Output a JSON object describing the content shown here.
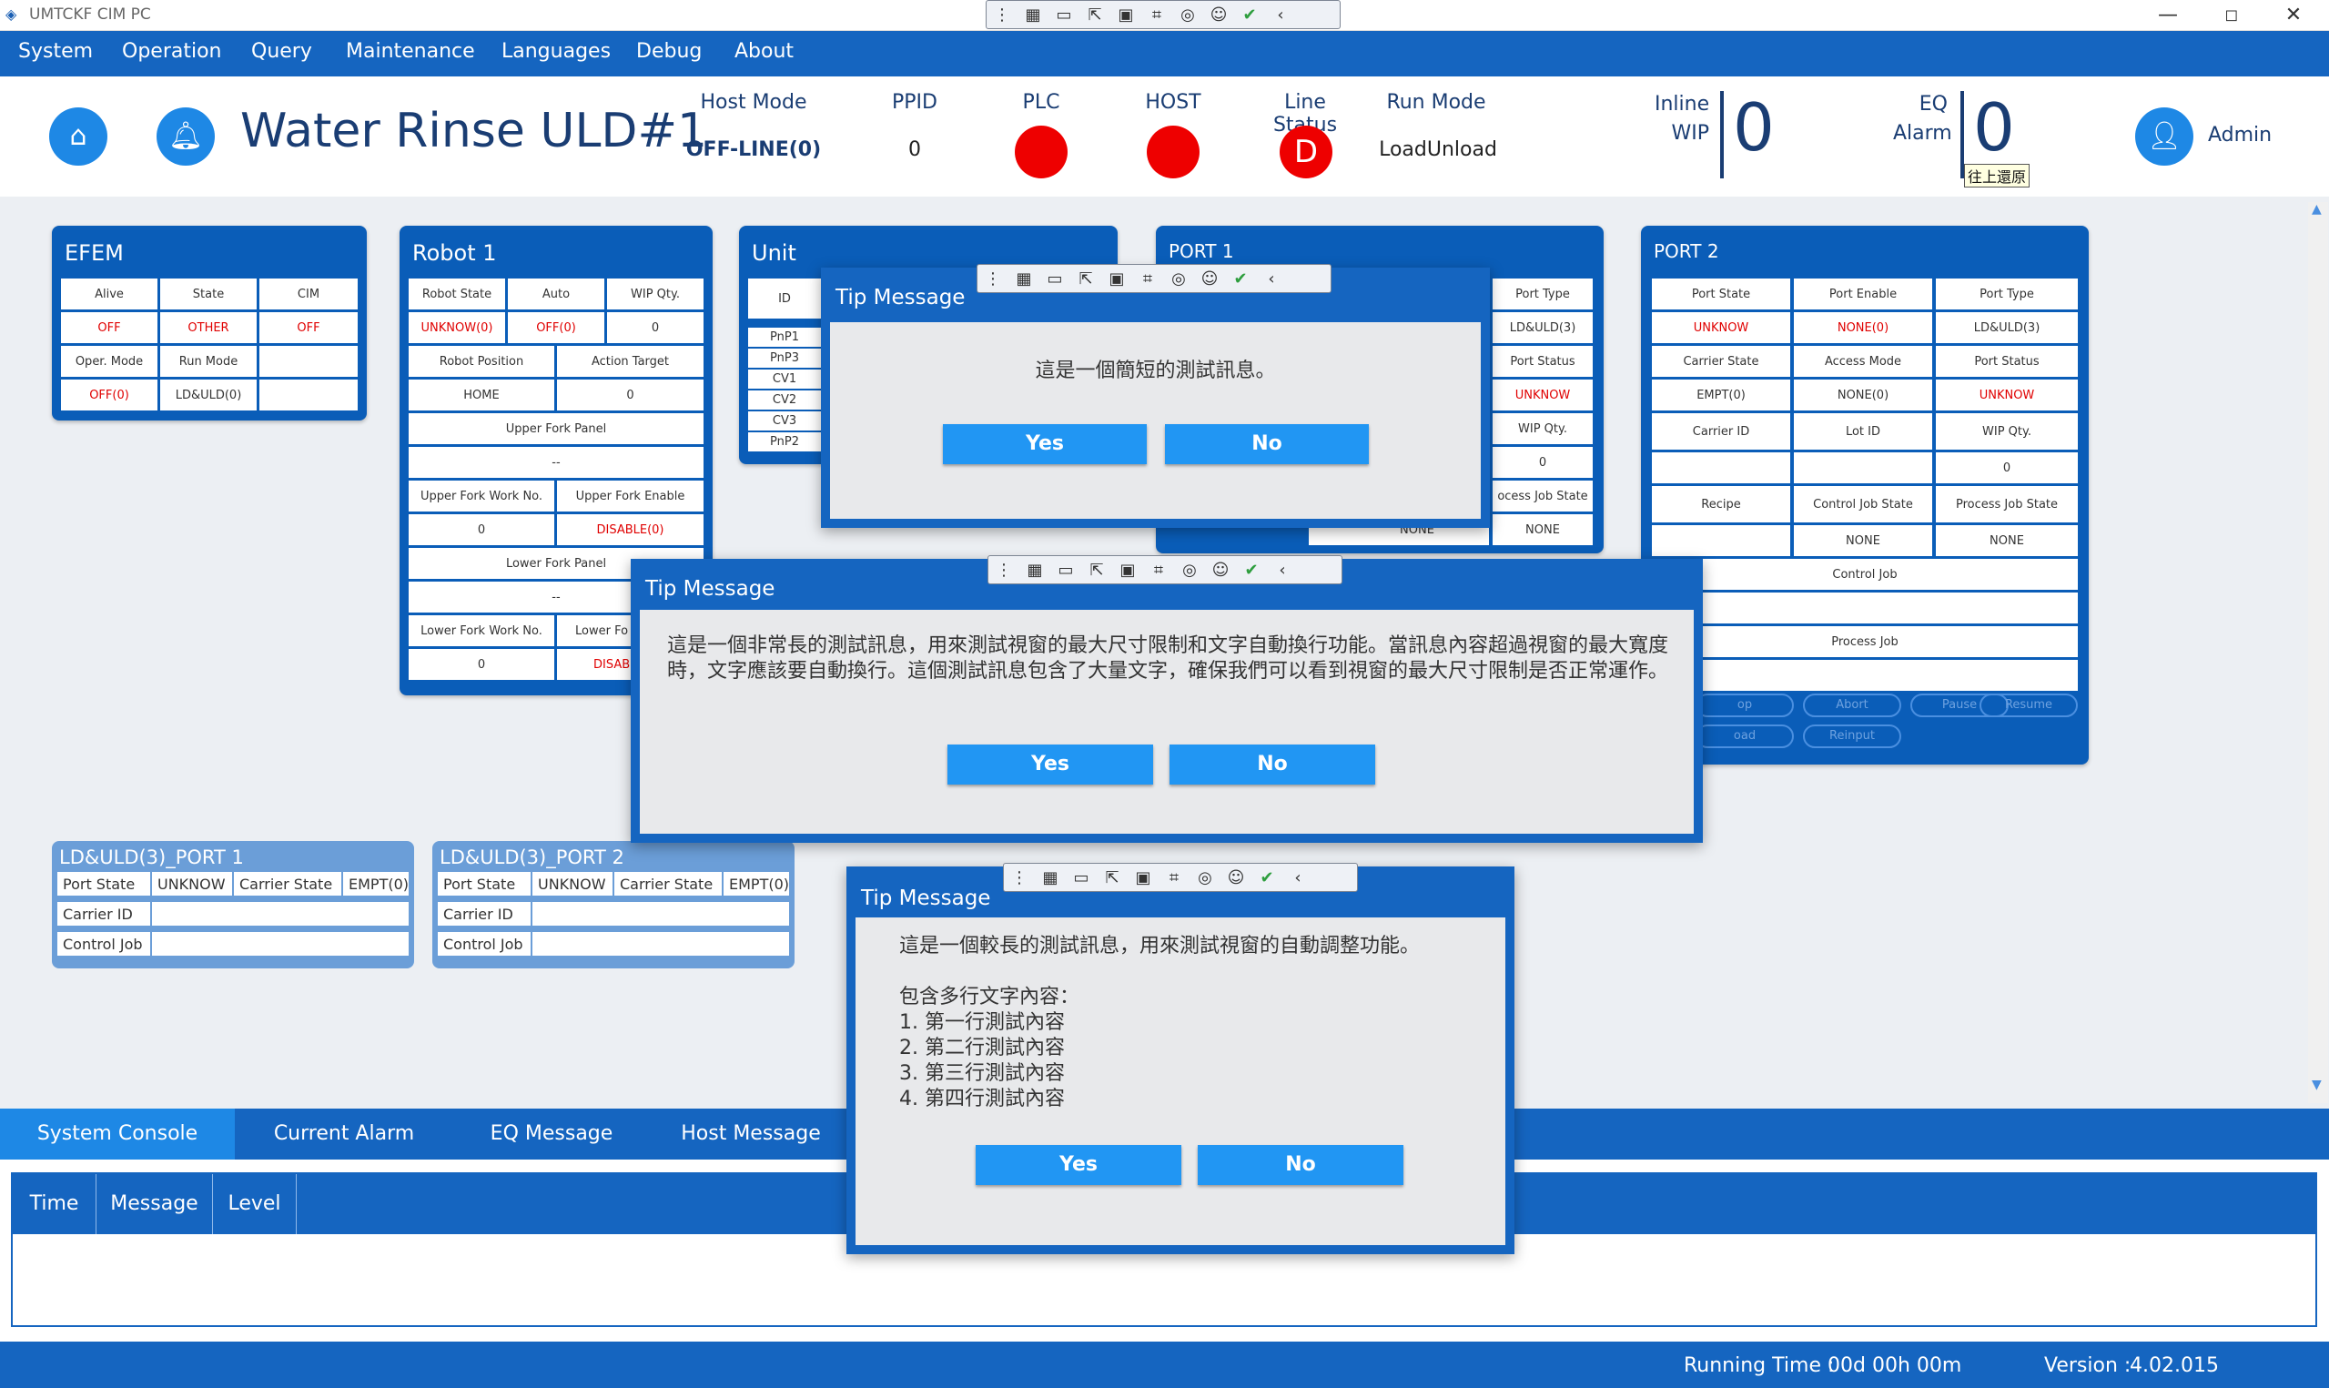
{
  "app": {
    "title": "UMTCKF CIM PC"
  },
  "window_controls": {
    "minimize": "—",
    "maximize": "◻",
    "close": "✕"
  },
  "menu": [
    "System",
    "Operation",
    "Query",
    "Maintenance",
    "Languages",
    "Debug",
    "About"
  ],
  "header": {
    "station_name": "Water Rinse ULD#1",
    "host_mode": {
      "label": "Host Mode",
      "value": "OFF-LINE(0)"
    },
    "ppid": {
      "label": "PPID",
      "value": "0"
    },
    "plc": {
      "label": "PLC"
    },
    "host": {
      "label": "HOST"
    },
    "line_status": {
      "label": "Line Status",
      "value": "D"
    },
    "run_mode": {
      "label": "Run Mode",
      "value": "LoadUnload"
    },
    "inline_wip": {
      "label1": "Inline",
      "label2": "WIP",
      "value": "0"
    },
    "eq_alarm": {
      "label1": "EQ",
      "label2": "Alarm",
      "value": "0",
      "tooltip": "往上還原"
    },
    "user": "Admin",
    "status_color": "#e00000"
  },
  "efem": {
    "title": "EFEM",
    "rows": [
      [
        "Alive",
        "State",
        "CIM"
      ],
      [
        "OFF",
        "OTHER",
        "OFF"
      ],
      [
        "Oper. Mode",
        "Run Mode",
        ""
      ],
      [
        "OFF(0)",
        "LD&ULD(0)",
        ""
      ]
    ]
  },
  "robot": {
    "title": "Robot 1",
    "r1": [
      "Robot State",
      "Auto",
      "WIP Qty."
    ],
    "r2": [
      "UNKNOW(0)",
      "OFF(0)",
      "0"
    ],
    "r3": [
      "Robot Position",
      "Action Target"
    ],
    "r4": [
      "HOME",
      "0"
    ],
    "upper_panel": "Upper Fork Panel",
    "dash1": "--",
    "r5": [
      "Upper Fork Work No.",
      "Upper Fork Enable"
    ],
    "r6": [
      "0",
      "DISABLE(0)"
    ],
    "lower_panel": "Lower Fork Panel",
    "dash2": "--",
    "r7": [
      "Lower Fork Work No.",
      "Lower Fo"
    ],
    "r8": [
      "0",
      "DISAB"
    ]
  },
  "unit": {
    "title": "Unit",
    "header": "ID",
    "items": [
      "PnP1",
      "PnP3",
      "CV1",
      "CV2",
      "CV3",
      "PnP2"
    ]
  },
  "port1": {
    "title": "PORT 1",
    "cells": [
      "Port Type",
      "LD&ULD(3)",
      "Port Status",
      "UNKNOW",
      "WIP Qty.",
      "0",
      "ocess Job State",
      "NONE",
      "NONE"
    ]
  },
  "port2": {
    "title": "PORT 2",
    "r1": [
      "Port State",
      "Port Enable",
      "Port Type"
    ],
    "r2": [
      "UNKNOW",
      "NONE(0)",
      "LD&ULD(3)"
    ],
    "r3": [
      "Carrier State",
      "Access Mode",
      "Port Status"
    ],
    "r4": [
      "EMPT(0)",
      "NONE(0)",
      "UNKNOW"
    ],
    "r5": [
      "Carrier ID",
      "Lot ID",
      "WIP Qty."
    ],
    "r6": [
      "",
      "",
      "0"
    ],
    "r7": [
      "Recipe",
      "Control Job State",
      "Process Job State"
    ],
    "r8": [
      "",
      "NONE",
      "NONE"
    ],
    "control_job": "Control Job",
    "process_job": "Process Job",
    "buttons": [
      "op",
      "Abort",
      "Pause",
      "Resume",
      "oad",
      "Reinput"
    ]
  },
  "ldport1": {
    "title": "LD&ULD(3)_PORT 1",
    "r1": [
      "Port State",
      "UNKNOW",
      "Carrier State",
      "EMPT(0)"
    ],
    "r2": [
      "Carrier ID"
    ],
    "r3": [
      "Control Job"
    ]
  },
  "ldport2": {
    "title": "LD&ULD(3)_PORT 2",
    "r1": [
      "Port State",
      "UNKNOW",
      "Carrier State",
      "EMPT(0)"
    ],
    "r2": [
      "Carrier ID"
    ],
    "r3": [
      "Control Job"
    ]
  },
  "dialogs": [
    {
      "title": "Tip Message",
      "text": "這是一個簡短的測試訊息。",
      "yes": "Yes",
      "no": "No"
    },
    {
      "title": "Tip Message",
      "text": "這是一個非常長的測試訊息，用來測試視窗的最大尺寸限制和文字自動換行功能。當訊息內容超過視窗的最大寬度時，文字應該要自動換行。這個測試訊息包含了大量文字，確保我們可以看到視窗的最大尺寸限制是否正常運作。",
      "yes": "Yes",
      "no": "No"
    },
    {
      "title": "Tip Message",
      "text": "這是一個較長的測試訊息，用來測試視窗的自動調整功能。\n\n包含多行文字內容：\n1. 第一行測試內容\n2. 第二行測試內容\n3. 第三行測試內容\n4. 第四行測試內容",
      "yes": "Yes",
      "no": "No"
    }
  ],
  "bottom_tabs": [
    "System Console",
    "Current Alarm",
    "EQ Message",
    "Host Message"
  ],
  "console_columns": [
    "Time",
    "Message",
    "Level"
  ],
  "status": {
    "running_time_label": "Running Time :",
    "running_time": "00d 00h 00m",
    "version_label": "Version :",
    "version": "4.02.015"
  }
}
